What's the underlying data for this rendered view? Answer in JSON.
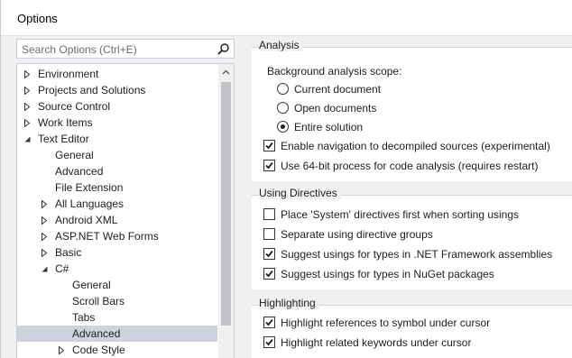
{
  "window": {
    "title": "Options"
  },
  "search": {
    "placeholder": "Search Options (Ctrl+E)",
    "value": ""
  },
  "tree": {
    "items": [
      {
        "label": "Environment",
        "level": 0,
        "expander": "collapsed",
        "selected": false
      },
      {
        "label": "Projects and Solutions",
        "level": 0,
        "expander": "collapsed",
        "selected": false
      },
      {
        "label": "Source Control",
        "level": 0,
        "expander": "collapsed",
        "selected": false
      },
      {
        "label": "Work Items",
        "level": 0,
        "expander": "collapsed",
        "selected": false
      },
      {
        "label": "Text Editor",
        "level": 0,
        "expander": "expanded",
        "selected": false
      },
      {
        "label": "General",
        "level": 1,
        "expander": "none",
        "selected": false
      },
      {
        "label": "Advanced",
        "level": 1,
        "expander": "none",
        "selected": false
      },
      {
        "label": "File Extension",
        "level": 1,
        "expander": "none",
        "selected": false
      },
      {
        "label": "All Languages",
        "level": 1,
        "expander": "collapsed",
        "selected": false
      },
      {
        "label": "Android XML",
        "level": 1,
        "expander": "collapsed",
        "selected": false
      },
      {
        "label": "ASP.NET Web Forms",
        "level": 1,
        "expander": "collapsed",
        "selected": false
      },
      {
        "label": "Basic",
        "level": 1,
        "expander": "collapsed",
        "selected": false
      },
      {
        "label": "C#",
        "level": 1,
        "expander": "expanded",
        "selected": false
      },
      {
        "label": "General",
        "level": 2,
        "expander": "none",
        "selected": false
      },
      {
        "label": "Scroll Bars",
        "level": 2,
        "expander": "none",
        "selected": false
      },
      {
        "label": "Tabs",
        "level": 2,
        "expander": "none",
        "selected": false
      },
      {
        "label": "Advanced",
        "level": 2,
        "expander": "none",
        "selected": true
      },
      {
        "label": "Code Style",
        "level": 2,
        "expander": "collapsed",
        "selected": false
      }
    ]
  },
  "analysis": {
    "header": "Analysis",
    "scope_label": "Background analysis scope:",
    "scope_options": [
      {
        "label": "Current document",
        "checked": false
      },
      {
        "label": "Open documents",
        "checked": false
      },
      {
        "label": "Entire solution",
        "checked": true
      }
    ],
    "checkboxes": [
      {
        "label": "Enable navigation to decompiled sources (experimental)",
        "checked": true
      },
      {
        "label": "Use 64-bit process for code analysis (requires restart)",
        "checked": true
      }
    ]
  },
  "using_directives": {
    "header": "Using Directives",
    "checkboxes": [
      {
        "label": "Place 'System' directives first when sorting usings",
        "checked": false
      },
      {
        "label": "Separate using directive groups",
        "checked": false
      },
      {
        "label": "Suggest usings for types in .NET Framework assemblies",
        "checked": true
      },
      {
        "label": "Suggest usings for types in NuGet packages",
        "checked": true
      }
    ]
  },
  "highlighting": {
    "header": "Highlighting",
    "checkboxes": [
      {
        "label": "Highlight references to symbol under cursor",
        "checked": true
      },
      {
        "label": "Highlight related keywords under cursor",
        "checked": true
      }
    ]
  },
  "icons": {
    "search": "search-icon",
    "scroll_up": "chevron-up-icon",
    "collapsed": "triangle-right-icon",
    "expanded": "triangle-down-icon"
  },
  "colors": {
    "selection": "#cdd2de",
    "border": "#cccedb",
    "scroll_thumb": "#c2c3c9"
  }
}
